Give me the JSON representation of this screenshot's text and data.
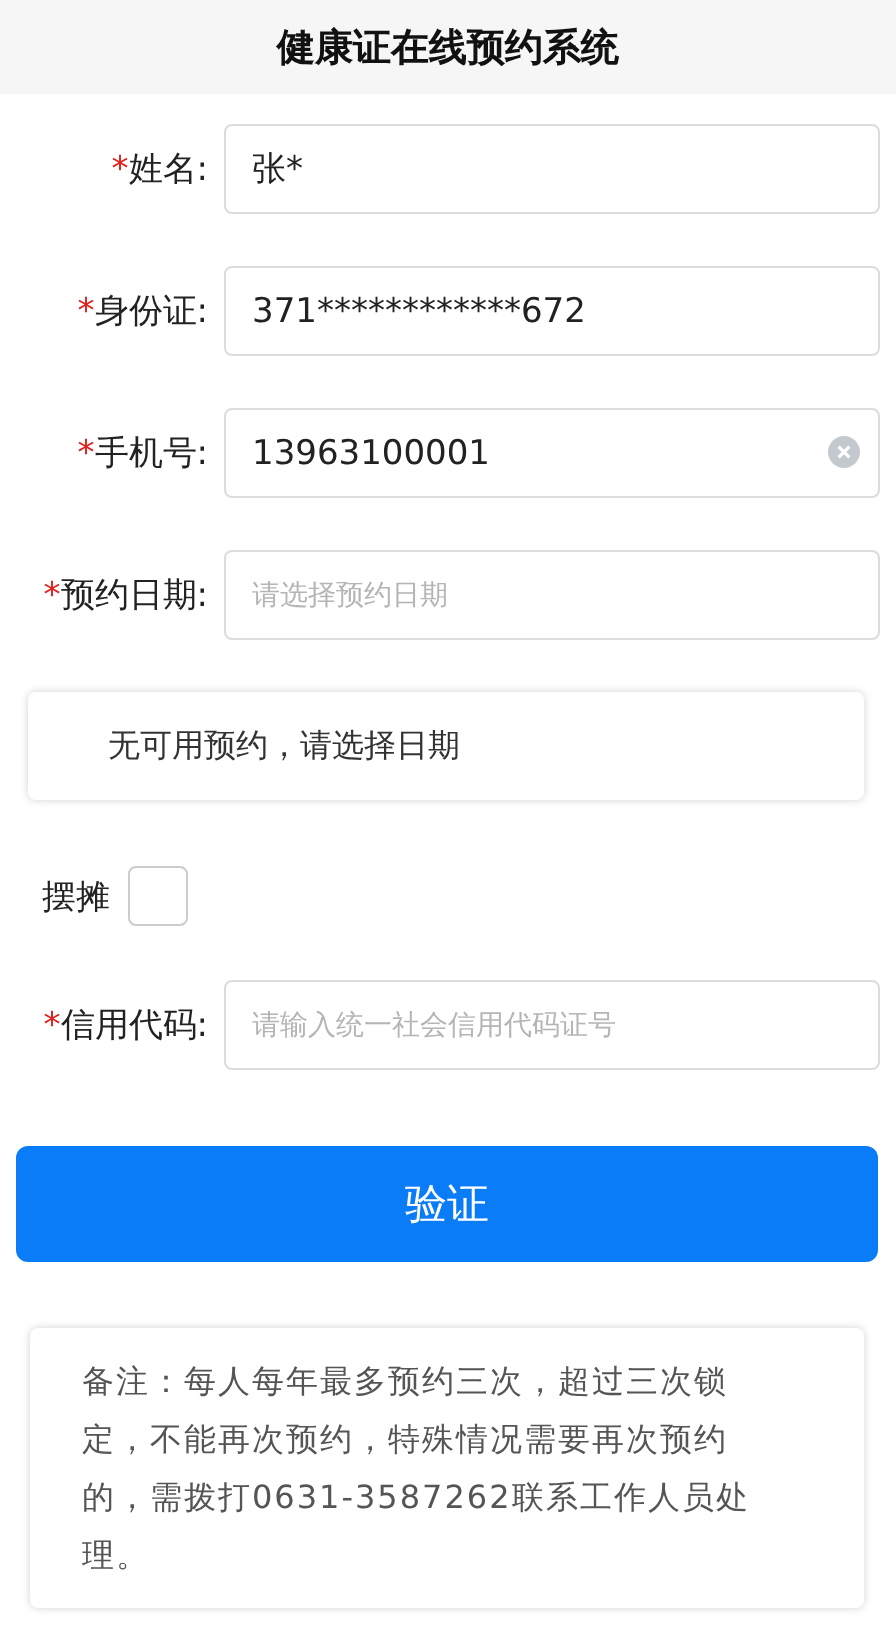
{
  "header": {
    "title": "健康证在线预约系统"
  },
  "fields": [
    {
      "mark": "*",
      "label": "姓名:",
      "value": "张*",
      "clearable": false
    },
    {
      "mark": "*",
      "label": "身份证:",
      "value": "371************672",
      "clearable": false
    },
    {
      "mark": "*",
      "label": "手机号:",
      "value": "13963100001",
      "clearable": true
    },
    {
      "mark": "*",
      "label": "预约日期:",
      "placeholder": "请选择预约日期",
      "clearable": false
    }
  ],
  "notice": "无可用预约，请选择日期",
  "stall": {
    "label": "摆摊",
    "checked": false
  },
  "credit_field": {
    "mark": "*",
    "label": "信用代码:",
    "placeholder": "请输入统一社会信用代码证号"
  },
  "submit_button": "验证",
  "note": "备注：每人每年最多预约三次，超过三次锁定，不能再次预约，特殊情况需要再次预约的，需拨打0631-3587262联系工作人员处理。"
}
